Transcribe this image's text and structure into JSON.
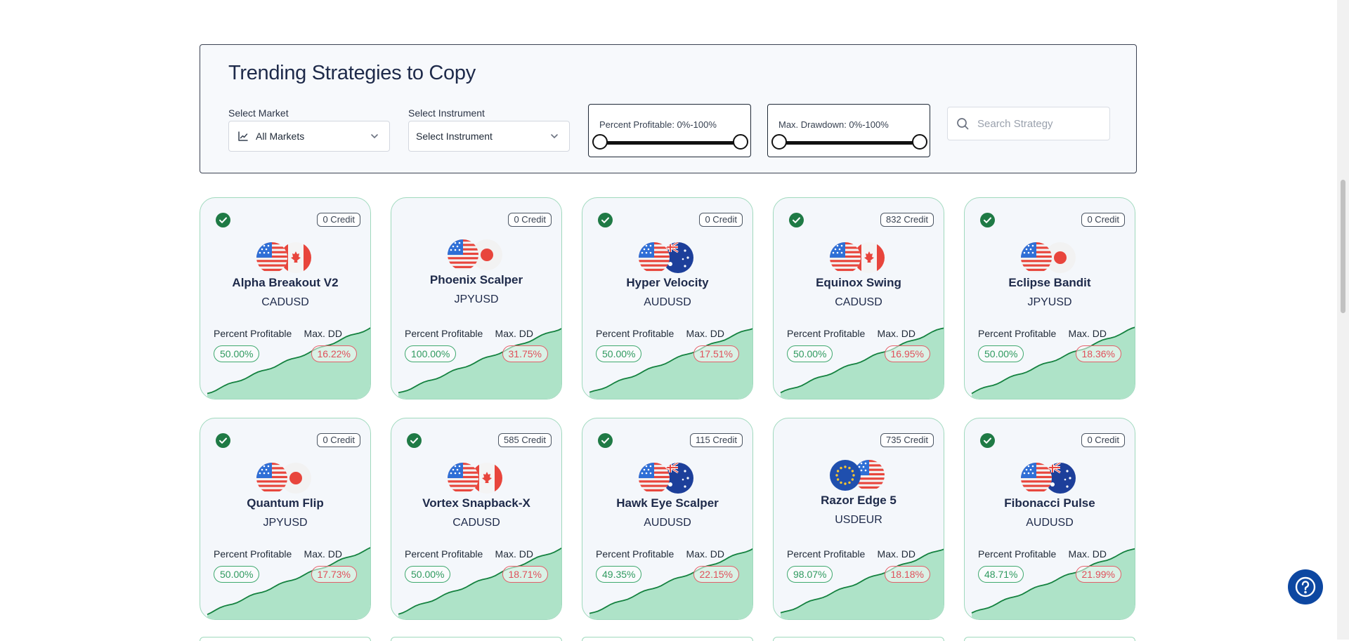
{
  "panel": {
    "title": "Trending Strategies to Copy",
    "market_label": "Select Market",
    "market_value": "All Markets",
    "instrument_label": "Select Instrument",
    "instrument_value": "Select Instrument",
    "percent_profitable": {
      "label": "Percent Profitable: 0%-100%",
      "min": 0,
      "max": 100
    },
    "max_drawdown": {
      "label": "Max. Drawdown: 0%-100%",
      "min": 0,
      "max": 100
    },
    "search_placeholder": "Search Strategy"
  },
  "card_labels": {
    "percent_profitable": "Percent Profitable",
    "max_dd": "Max. DD"
  },
  "strategies": [
    {
      "name": "Alpha Breakout V2",
      "instrument": "CADUSD",
      "credit": "0 Credit",
      "verified": true,
      "profitable": "50.00%",
      "max_dd": "16.22%",
      "flags": [
        "us",
        "ca"
      ]
    },
    {
      "name": "Phoenix Scalper",
      "instrument": "JPYUSD",
      "credit": "0 Credit",
      "verified": false,
      "profitable": "100.00%",
      "max_dd": "31.75%",
      "flags": [
        "us",
        "jp"
      ]
    },
    {
      "name": "Hyper Velocity",
      "instrument": "AUDUSD",
      "credit": "0 Credit",
      "verified": true,
      "profitable": "50.00%",
      "max_dd": "17.51%",
      "flags": [
        "us",
        "au"
      ]
    },
    {
      "name": "Equinox Swing",
      "instrument": "CADUSD",
      "credit": "832 Credit",
      "verified": true,
      "profitable": "50.00%",
      "max_dd": "16.95%",
      "flags": [
        "us",
        "ca"
      ]
    },
    {
      "name": "Eclipse Bandit",
      "instrument": "JPYUSD",
      "credit": "0 Credit",
      "verified": true,
      "profitable": "50.00%",
      "max_dd": "18.36%",
      "flags": [
        "us",
        "jp"
      ]
    },
    {
      "name": "Quantum Flip",
      "instrument": "JPYUSD",
      "credit": "0 Credit",
      "verified": true,
      "profitable": "50.00%",
      "max_dd": "17.73%",
      "flags": [
        "us",
        "jp"
      ]
    },
    {
      "name": "Vortex Snapback-X",
      "instrument": "CADUSD",
      "credit": "585 Credit",
      "verified": true,
      "profitable": "50.00%",
      "max_dd": "18.71%",
      "flags": [
        "us",
        "ca"
      ]
    },
    {
      "name": "Hawk Eye Scalper",
      "instrument": "AUDUSD",
      "credit": "115 Credit",
      "verified": true,
      "profitable": "49.35%",
      "max_dd": "22.15%",
      "flags": [
        "us",
        "au"
      ]
    },
    {
      "name": "Razor Edge 5",
      "instrument": "USDEUR",
      "credit": "735 Credit",
      "verified": false,
      "profitable": "98.07%",
      "max_dd": "18.18%",
      "flags": [
        "eu",
        "us"
      ]
    },
    {
      "name": "Fibonacci Pulse",
      "instrument": "AUDUSD",
      "credit": "0 Credit",
      "verified": true,
      "profitable": "48.71%",
      "max_dd": "21.99%",
      "flags": [
        "us",
        "au"
      ]
    }
  ],
  "colors": {
    "green": "#2f9a5f",
    "red": "#e0505b",
    "chart_fill": "#aee3c8",
    "chart_line": "#14813f",
    "check": "#1f7a45",
    "help": "#0d47a1"
  },
  "icons": {
    "check": "check-circle-icon",
    "search": "search-icon",
    "chevron": "chevron-down-icon",
    "help": "question-circle-icon"
  }
}
